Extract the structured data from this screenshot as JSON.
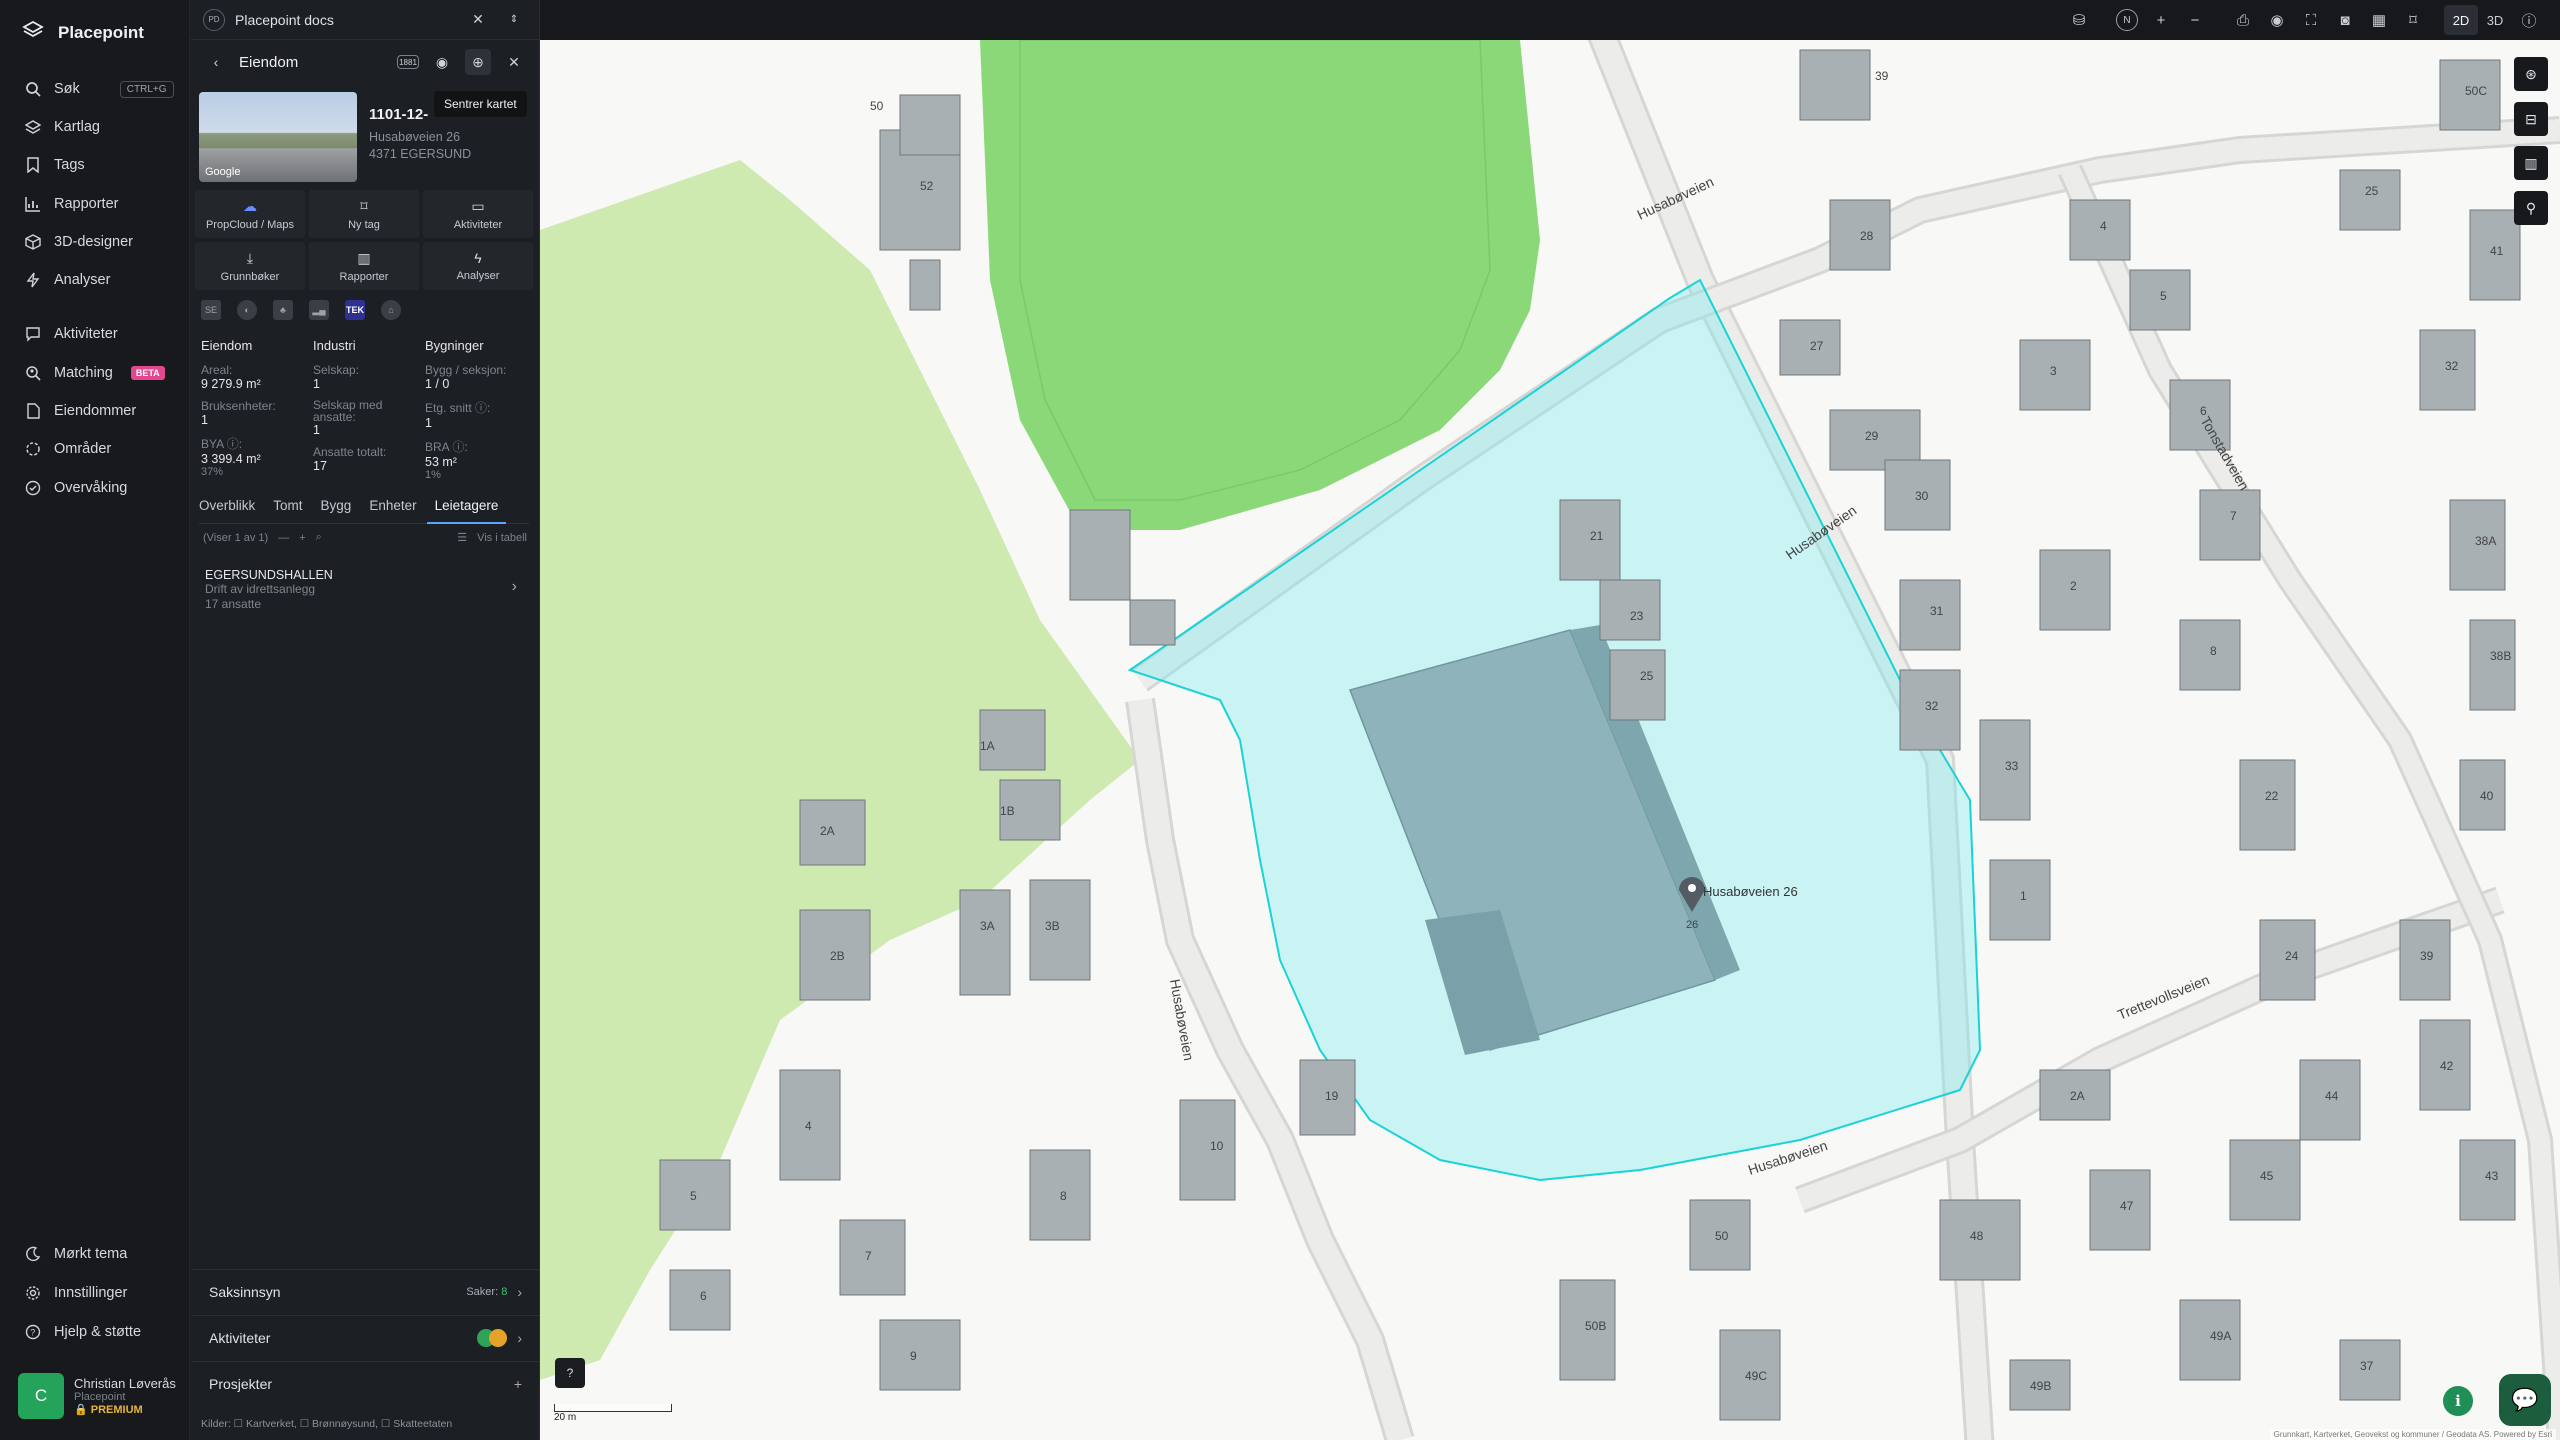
{
  "app": {
    "brand": "Placepoint"
  },
  "nav": {
    "items": [
      {
        "label": "Søk",
        "icon": "search-icon",
        "shortcut": "CTRL+G"
      },
      {
        "label": "Kartlag",
        "icon": "layers-icon"
      },
      {
        "label": "Tags",
        "icon": "bookmark-icon"
      },
      {
        "label": "Rapporter",
        "icon": "chart-icon"
      },
      {
        "label": "3D-designer",
        "icon": "cube-icon"
      },
      {
        "label": "Analyser",
        "icon": "bolt-icon"
      },
      {
        "label": "Aktiviteter",
        "icon": "chat-icon"
      },
      {
        "label": "Matching",
        "icon": "search-person-icon",
        "badge": "BETA"
      },
      {
        "label": "Eiendommer",
        "icon": "file-icon"
      },
      {
        "label": "Områder",
        "icon": "dashed-circle-icon"
      },
      {
        "label": "Overvåking",
        "icon": "check-circle-icon"
      }
    ],
    "bottom": [
      {
        "label": "Mørkt tema",
        "icon": "moon-icon"
      },
      {
        "label": "Innstillinger",
        "icon": "gear-icon"
      },
      {
        "label": "Hjelp & støtte",
        "icon": "help-icon"
      }
    ],
    "user": {
      "initial": "C",
      "name": "Christian Løverås",
      "org": "Placepoint",
      "plan": "PREMIUM"
    }
  },
  "panel": {
    "doc_badge": "PD",
    "doc_title": "Placepoint docs",
    "title": "Eiendom",
    "tooltip": "Sentrer kartet",
    "property": {
      "id": "1101-12-",
      "address": "Husabøveien 26",
      "postal": "4371 EGERSUND",
      "image_credit": "Google"
    },
    "actions": [
      {
        "label": "PropCloud / Maps",
        "icon": "cloud-icon"
      },
      {
        "label": "Ny tag",
        "icon": "bookmark-icon"
      },
      {
        "label": "Aktiviteter",
        "icon": "chat-icon"
      },
      {
        "label": "Grunnbøker",
        "icon": "download-icon"
      },
      {
        "label": "Rapporter",
        "icon": "chart-icon"
      },
      {
        "label": "Analyser",
        "icon": "bolt-icon"
      }
    ],
    "sources": [
      "SE",
      "",
      "",
      "",
      "TEK",
      ""
    ],
    "stats": {
      "eiendom": {
        "heading": "Eiendom",
        "areal_label": "Areal:",
        "areal": "9 279.9 m²",
        "bruks_label": "Bruksenheter:",
        "bruks": "1",
        "bya_label": "BYA ⓘ:",
        "bya": "3 399.4 m²",
        "bya_pct": "37%"
      },
      "industri": {
        "heading": "Industri",
        "selskap_label": "Selskap:",
        "selskap": "1",
        "ansatte_label": "Selskap med ansatte:",
        "ansatte": "1",
        "totalt_label": "Ansatte totalt:",
        "totalt": "17"
      },
      "bygninger": {
        "heading": "Bygninger",
        "bygg_label": "Bygg / seksjon:",
        "bygg": "1 / 0",
        "etg_label": "Etg. snitt ⓘ:",
        "etg": "1",
        "bra_label": "BRA ⓘ:",
        "bra": "53 m²",
        "bra_pct": "1%"
      }
    },
    "tabs": [
      "Overblikk",
      "Tomt",
      "Bygg",
      "Enheter",
      "Leietagere"
    ],
    "filter": {
      "showing": "(Viser 1 av 1)",
      "table_link": "Vis i tabell"
    },
    "tenant": {
      "name": "EGERSUNDSHALLEN",
      "activity": "Drift av idrettsanlegg",
      "employees": "17 ansatte"
    },
    "sections": [
      {
        "label": "Saksinnsyn",
        "meta_prefix": "Saker:",
        "meta_value": "8"
      },
      {
        "label": "Aktiviteter"
      },
      {
        "label": "Prosjekter"
      }
    ],
    "sources_footer": "Kilder: ☐ Kartverket, ☐ Brønnøysund, ☐ Skatteetaten"
  },
  "topbar": {
    "north": "N",
    "mode_2d": "2D",
    "mode_3d": "3D"
  },
  "map": {
    "scale": "20 m",
    "attribution": "Grunnkart, Kartverket, Geovekst og kommuner / Geodata AS. Powered by Esri",
    "marker_label": "Husabøveien 26",
    "marker_num": "26",
    "streets": [
      "Husabøveien",
      "Husabøveien",
      "Husabøveien",
      "Husabøveien",
      "Trettevollsveien",
      "Tonstadveien"
    ],
    "house_numbers": [
      "52",
      "50",
      "1A",
      "1B",
      "2A",
      "2B",
      "3A",
      "3B",
      "4",
      "5",
      "6",
      "7",
      "8",
      "9",
      "10",
      "19",
      "21",
      "23",
      "25",
      "27",
      "28",
      "29",
      "30",
      "31",
      "32",
      "33",
      "1",
      "2",
      "3",
      "4",
      "5",
      "6",
      "7",
      "8",
      "22",
      "24",
      "25",
      "32",
      "38A",
      "38B",
      "40",
      "39",
      "42",
      "43",
      "44",
      "45",
      "47",
      "48",
      "49A",
      "49B",
      "49C",
      "50",
      "50B",
      "50C",
      "41",
      "2A",
      "37",
      "39"
    ]
  },
  "colors": {
    "accent": "#5aa4ff",
    "highlight": "#19d3d6",
    "park": "#8ad878",
    "forest": "#cfeab1"
  }
}
